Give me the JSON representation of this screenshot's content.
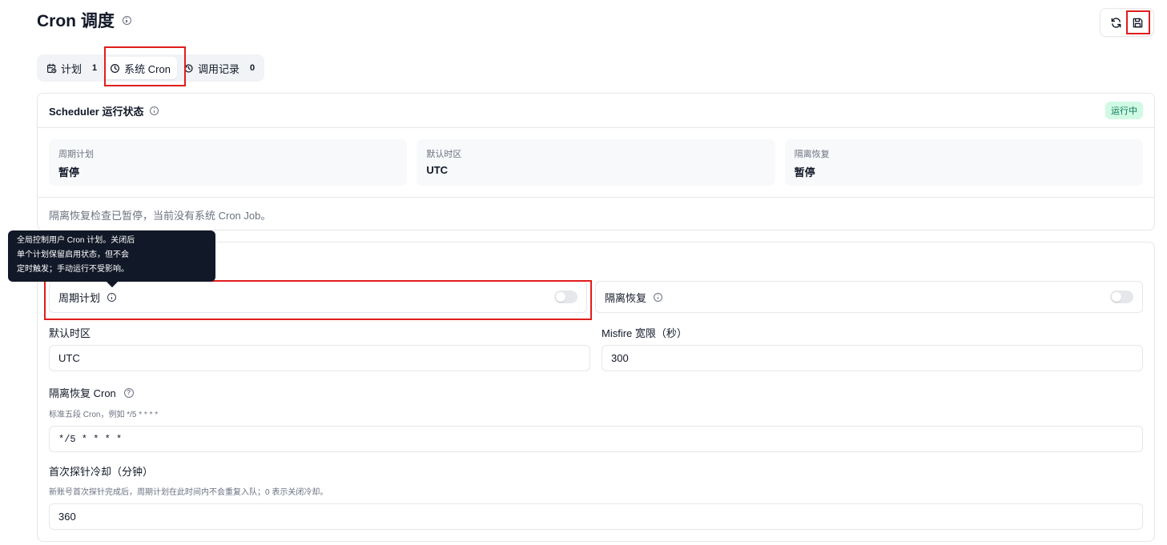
{
  "page": {
    "title": "Cron 调度"
  },
  "toolbar": {
    "refresh_icon": "refresh-icon",
    "save_icon": "save-icon"
  },
  "tabs": [
    {
      "label": "计划",
      "count": "1",
      "icon": "calendar-clock-icon"
    },
    {
      "label": "系统 Cron",
      "count": "",
      "icon": "clock-icon"
    },
    {
      "label": "调用记录",
      "count": "0",
      "icon": "history-icon"
    }
  ],
  "status": {
    "title": "Scheduler 运行状态",
    "badge": "运行中",
    "stats": [
      {
        "label": "周期计划",
        "value": "暂停"
      },
      {
        "label": "默认时区",
        "value": "UTC"
      },
      {
        "label": "隔离恢复",
        "value": "暂停"
      }
    ],
    "note": "隔离恢复检查已暂停，当前没有系统 Cron Job。"
  },
  "tooltip": {
    "lines": [
      "全局控制用户 Cron 计划。关闭后",
      "单个计划保留启用状态，但不会",
      "定时触发；手动运行不受影响。"
    ]
  },
  "settings": {
    "periodic_plan": {
      "label": "周期计划",
      "enabled": false
    },
    "isolation_recovery": {
      "label": "隔离恢复",
      "enabled": false
    },
    "default_timezone": {
      "label": "默认时区",
      "value": "UTC"
    },
    "misfire_grace": {
      "label": "Misfire 宽限（秒）",
      "value": "300"
    },
    "isolation_cron": {
      "label": "隔离恢复 Cron",
      "hint": "标准五段 Cron，例如 */5 * * * *",
      "value": "*/5 * * * *"
    },
    "first_probe_cooldown": {
      "label": "首次探针冷却（分钟）",
      "hint": "新账号首次探针完成后，周期计划在此时间内不会重复入队；0 表示关闭冷却。",
      "value": "360"
    }
  },
  "colors": {
    "accent_highlight": "#e11d1d",
    "badge_bg": "#d1fae5",
    "badge_text": "#047857",
    "tooltip_bg": "#111827"
  }
}
